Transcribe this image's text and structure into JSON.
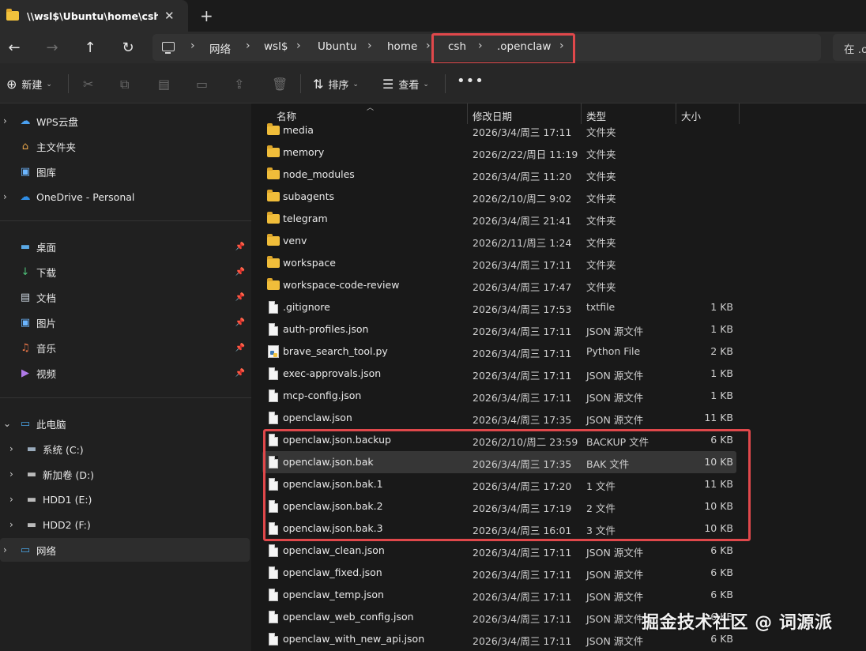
{
  "tab": {
    "title": "\\\\wsl$\\Ubuntu\\home\\csh\\.openclaw",
    "close": "✕",
    "new_tab": "+"
  },
  "nav": {
    "back": "←",
    "forward": "→",
    "up": "↑",
    "refresh": "↻"
  },
  "breadcrumb": [
    "网络",
    "wsl$",
    "Ubuntu",
    "home",
    "csh",
    ".openclaw"
  ],
  "breadcrumb_sep": "›",
  "search_placeholder": "在 .o",
  "toolbar": {
    "new_label": "新建",
    "sort_label": "排序",
    "view_label": "查看",
    "more": "•••"
  },
  "sidebar": {
    "top_items": [
      {
        "label": "WPS云盘",
        "icon": "cloud-icon"
      },
      {
        "label": "主文件夹",
        "icon": "home-icon"
      },
      {
        "label": "图库",
        "icon": "gallery-icon"
      },
      {
        "label": "OneDrive - Personal",
        "icon": "onedrive-icon"
      }
    ],
    "quick_access": [
      {
        "label": "桌面",
        "icon": "desktop-icon"
      },
      {
        "label": "下载",
        "icon": "download-icon"
      },
      {
        "label": "文档",
        "icon": "documents-icon"
      },
      {
        "label": "图片",
        "icon": "pictures-icon"
      },
      {
        "label": "音乐",
        "icon": "music-icon"
      },
      {
        "label": "视频",
        "icon": "video-icon"
      }
    ],
    "this_pc": "此电脑",
    "drives": [
      {
        "label": "系统 (C:)"
      },
      {
        "label": "新加卷 (D:)"
      },
      {
        "label": "HDD1 (E:)"
      },
      {
        "label": "HDD2 (F:)"
      }
    ],
    "network": "网络"
  },
  "columns": {
    "name": "名称",
    "date": "修改日期",
    "type": "类型",
    "size": "大小"
  },
  "files": [
    {
      "name": "media",
      "date": "2026/3/4/周三 17:11",
      "type": "文件夹",
      "size": "",
      "kind": "folder"
    },
    {
      "name": "memory",
      "date": "2026/2/22/周日 11:19",
      "type": "文件夹",
      "size": "",
      "kind": "folder"
    },
    {
      "name": "node_modules",
      "date": "2026/3/4/周三 11:20",
      "type": "文件夹",
      "size": "",
      "kind": "folder"
    },
    {
      "name": "subagents",
      "date": "2026/2/10/周二 9:02",
      "type": "文件夹",
      "size": "",
      "kind": "folder"
    },
    {
      "name": "telegram",
      "date": "2026/3/4/周三 21:41",
      "type": "文件夹",
      "size": "",
      "kind": "folder"
    },
    {
      "name": "venv",
      "date": "2026/2/11/周三 1:24",
      "type": "文件夹",
      "size": "",
      "kind": "folder"
    },
    {
      "name": "workspace",
      "date": "2026/3/4/周三 17:11",
      "type": "文件夹",
      "size": "",
      "kind": "folder"
    },
    {
      "name": "workspace-code-review",
      "date": "2026/3/4/周三 17:47",
      "type": "文件夹",
      "size": "",
      "kind": "folder"
    },
    {
      "name": ".gitignore",
      "date": "2026/3/4/周三 17:53",
      "type": "txtfile",
      "size": "1 KB",
      "kind": "file"
    },
    {
      "name": "auth-profiles.json",
      "date": "2026/3/4/周三 17:11",
      "type": "JSON 源文件",
      "size": "1 KB",
      "kind": "file"
    },
    {
      "name": "brave_search_tool.py",
      "date": "2026/3/4/周三 17:11",
      "type": "Python File",
      "size": "2 KB",
      "kind": "python"
    },
    {
      "name": "exec-approvals.json",
      "date": "2026/3/4/周三 17:11",
      "type": "JSON 源文件",
      "size": "1 KB",
      "kind": "file"
    },
    {
      "name": "mcp-config.json",
      "date": "2026/3/4/周三 17:11",
      "type": "JSON 源文件",
      "size": "1 KB",
      "kind": "file"
    },
    {
      "name": "openclaw.json",
      "date": "2026/3/4/周三 17:35",
      "type": "JSON 源文件",
      "size": "11 KB",
      "kind": "file"
    },
    {
      "name": "openclaw.json.backup",
      "date": "2026/2/10/周二 23:59",
      "type": "BACKUP 文件",
      "size": "6 KB",
      "kind": "file"
    },
    {
      "name": "openclaw.json.bak",
      "date": "2026/3/4/周三 17:35",
      "type": "BAK 文件",
      "size": "10 KB",
      "kind": "file",
      "selected": true
    },
    {
      "name": "openclaw.json.bak.1",
      "date": "2026/3/4/周三 17:20",
      "type": "1 文件",
      "size": "11 KB",
      "kind": "file"
    },
    {
      "name": "openclaw.json.bak.2",
      "date": "2026/3/4/周三 17:19",
      "type": "2 文件",
      "size": "10 KB",
      "kind": "file"
    },
    {
      "name": "openclaw.json.bak.3",
      "date": "2026/3/4/周三 16:01",
      "type": "3 文件",
      "size": "10 KB",
      "kind": "file"
    },
    {
      "name": "openclaw_clean.json",
      "date": "2026/3/4/周三 17:11",
      "type": "JSON 源文件",
      "size": "6 KB",
      "kind": "file"
    },
    {
      "name": "openclaw_fixed.json",
      "date": "2026/3/4/周三 17:11",
      "type": "JSON 源文件",
      "size": "6 KB",
      "kind": "file"
    },
    {
      "name": "openclaw_temp.json",
      "date": "2026/3/4/周三 17:11",
      "type": "JSON 源文件",
      "size": "6 KB",
      "kind": "file"
    },
    {
      "name": "openclaw_web_config.json",
      "date": "2026/3/4/周三 17:11",
      "type": "JSON 源文件",
      "size": "6 KB",
      "kind": "file"
    },
    {
      "name": "openclaw_with_new_api.json",
      "date": "2026/3/4/周三 17:11",
      "type": "JSON 源文件",
      "size": "6 KB",
      "kind": "file"
    }
  ],
  "watermark": "掘金技术社区 @ 词源派",
  "colors": {
    "highlight": "#e0484b",
    "folder": "#f0bd3a",
    "background": "#191919"
  }
}
